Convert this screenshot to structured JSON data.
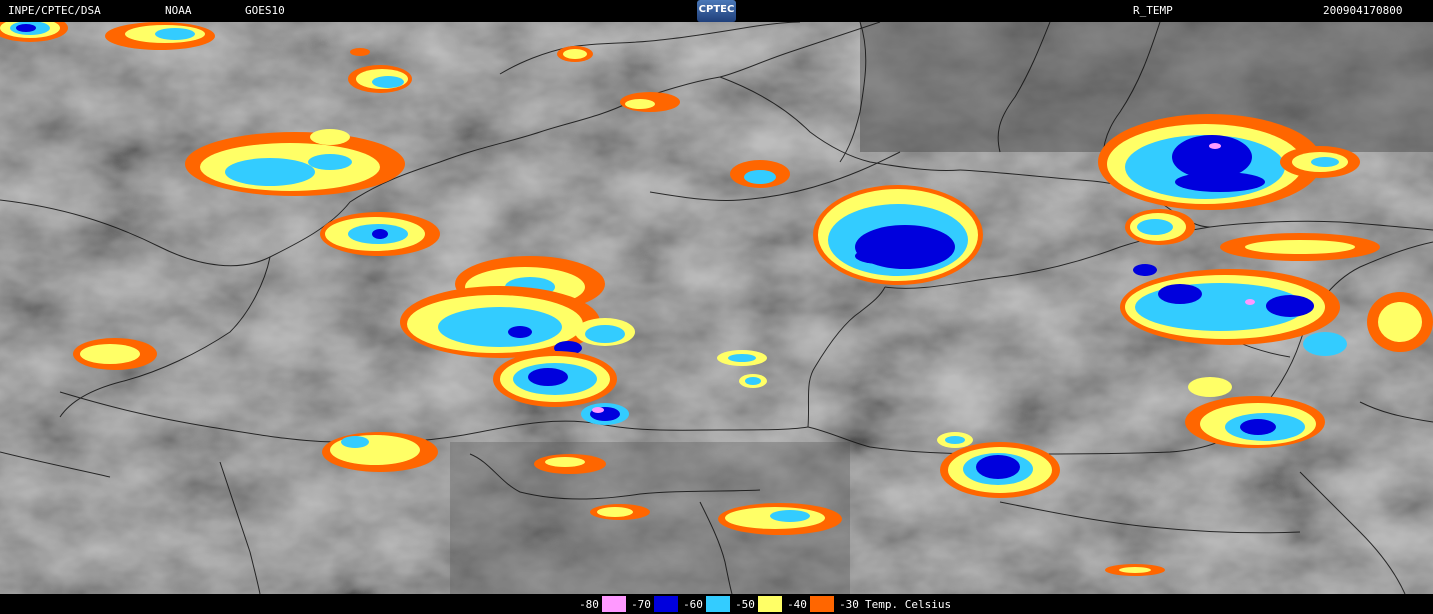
{
  "header": {
    "source": "INPE/CPTEC/DSA",
    "agency": "NOAA",
    "satellite": "GOES10",
    "logo": "CPTEC",
    "product": "R_TEMP",
    "timestamp": "200904170800"
  },
  "legend": {
    "items": [
      {
        "label": "-80",
        "color": "#ff99ff"
      },
      {
        "label": "-70",
        "color": "#0000dd"
      },
      {
        "label": "-60",
        "color": "#33ccff"
      },
      {
        "label": "-50",
        "color": "#ffff66"
      },
      {
        "label": "-40",
        "color": "#ff6600"
      },
      {
        "label": "-30",
        "color": "#000000"
      }
    ],
    "unit": "Temp. Celsius"
  }
}
